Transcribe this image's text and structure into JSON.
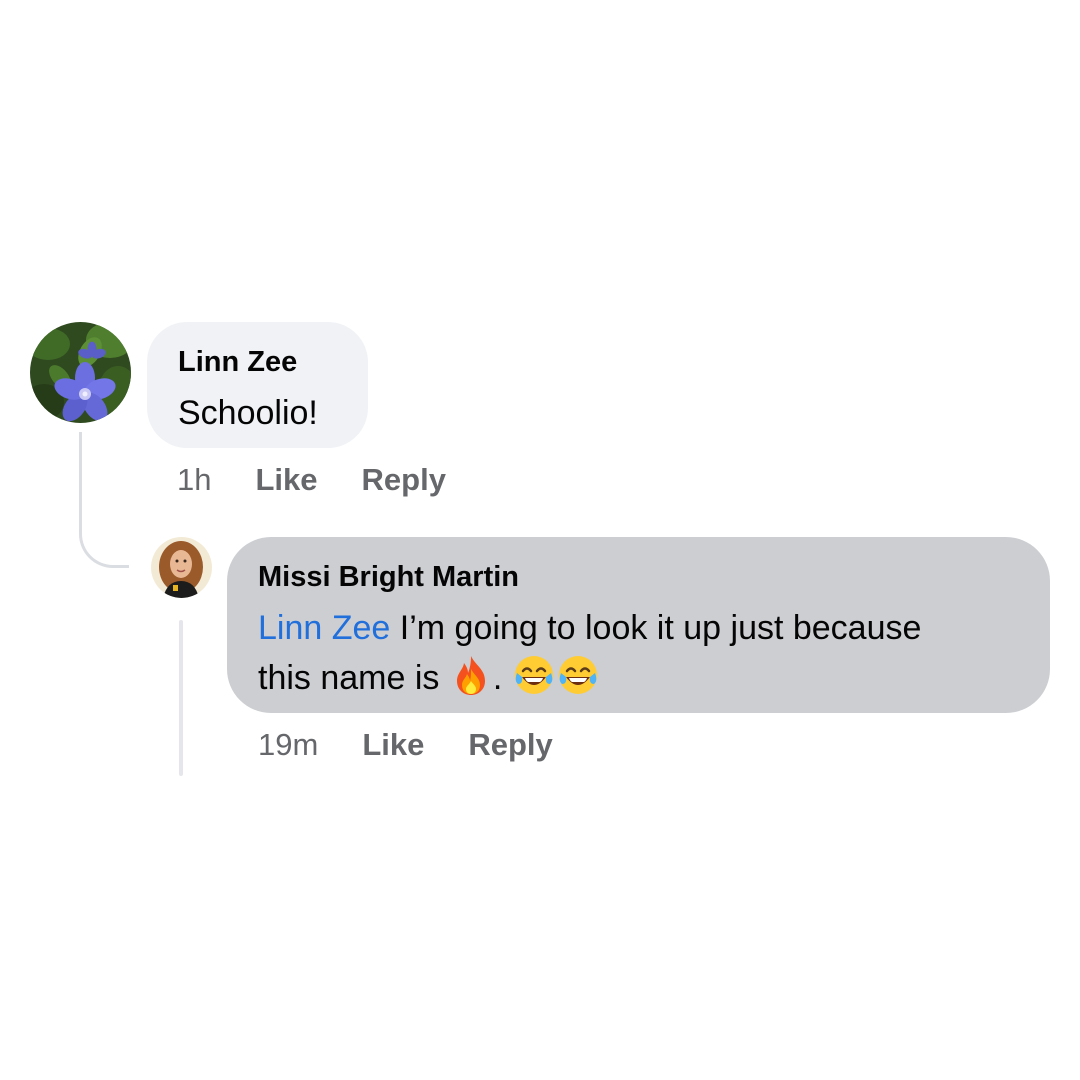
{
  "comments": [
    {
      "author": "Linn Zee",
      "text": "Schoolio!",
      "time": "1h",
      "like_label": "Like",
      "reply_label": "Reply"
    },
    {
      "author": "Missi Bright Martin",
      "mention": "Linn Zee",
      "text_line1": " I’m going to look it up just because",
      "text_line2": "this name is ",
      "punct": ".",
      "emojis": [
        "fire-emoji",
        "tears-of-joy-emoji",
        "tears-of-joy-emoji"
      ],
      "time": "19m",
      "like_label": "Like",
      "reply_label": "Reply"
    }
  ],
  "colors": {
    "background": "#ffffff",
    "bubble_parent": "#f0f2f5",
    "bubble_reply": "#ccced2",
    "mention": "#216fdb",
    "meta_text": "#65676b"
  }
}
